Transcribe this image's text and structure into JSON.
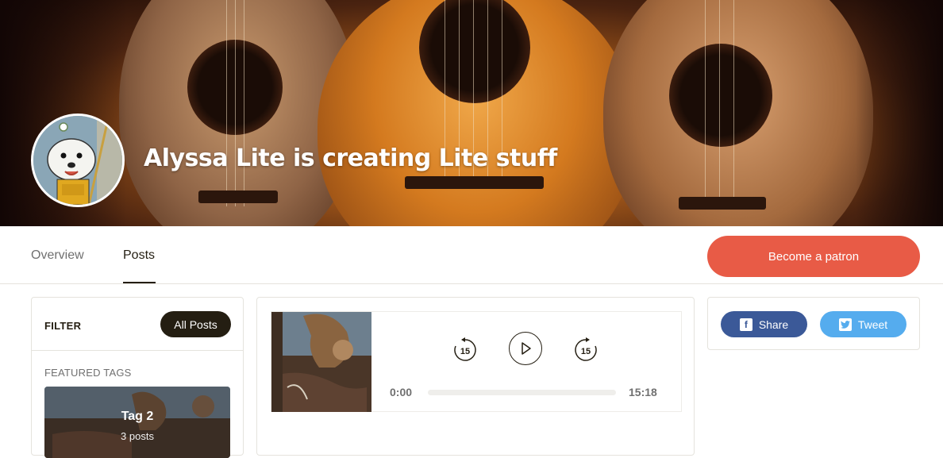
{
  "creator": {
    "title": "Alyssa Lite is creating Lite stuff"
  },
  "nav": {
    "tabs": [
      {
        "label": "Overview",
        "active": false
      },
      {
        "label": "Posts",
        "active": true
      }
    ],
    "cta_label": "Become a patron",
    "cta_color": "#e85b46"
  },
  "filter": {
    "label": "FILTER",
    "all_posts_label": "All Posts",
    "featured_label": "FEATURED TAGS",
    "tags": [
      {
        "name": "Tag 2",
        "count": "3 posts"
      }
    ]
  },
  "post": {
    "player": {
      "rewind_seconds": "15",
      "forward_seconds": "15",
      "current_time": "0:00",
      "total_time": "15:18",
      "progress": 0
    }
  },
  "share": {
    "facebook_label": "Share",
    "twitter_label": "Tweet",
    "facebook_color": "#3b5998",
    "twitter_color": "#55acee",
    "facebook_icon": "facebook-icon",
    "twitter_icon": "twitter-icon"
  }
}
